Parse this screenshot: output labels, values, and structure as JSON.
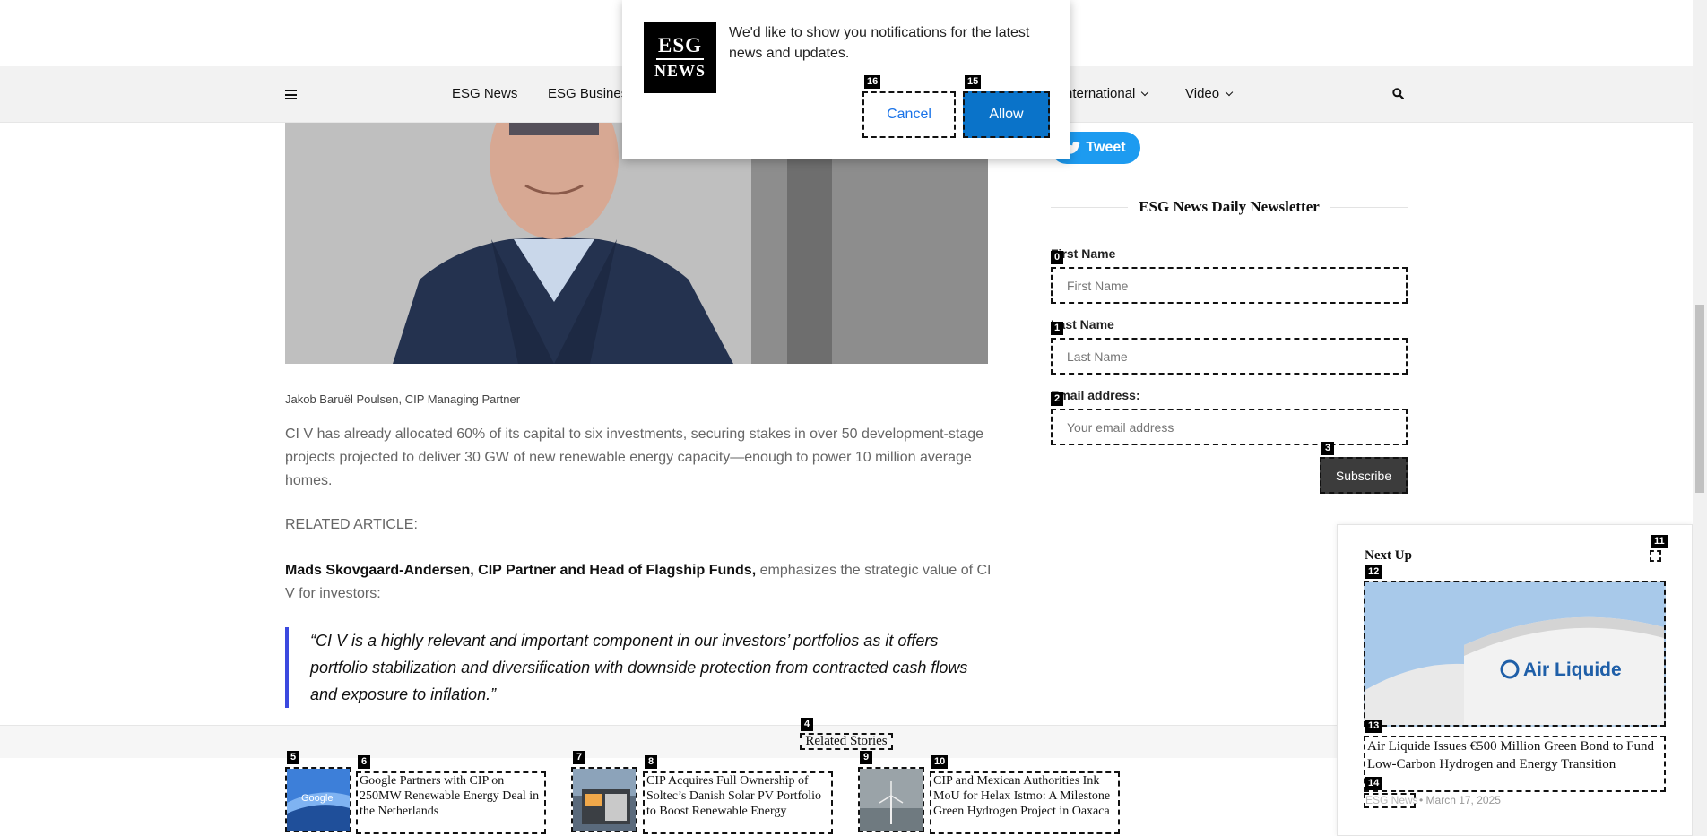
{
  "nav": {
    "links": [
      {
        "label": "ESG News",
        "has_caret": false
      },
      {
        "label": "ESG Business",
        "has_caret": false
      },
      {
        "label": "nternational",
        "has_caret": true
      },
      {
        "label": "Video",
        "has_caret": true
      }
    ],
    "menu_icon": "hamburger-icon",
    "search_icon": "search-icon"
  },
  "popup": {
    "logo_line1": "ESG",
    "logo_line2": "NEWS",
    "message": "We'd like to show you notifications for the latest news and updates.",
    "cancel_label": "Cancel",
    "allow_label": "Allow",
    "allow_color": "#0a73c9"
  },
  "article": {
    "image_caption": "Jakob Baruël Poulsen, CIP Managing Partner",
    "paragraph1": "CI V has already allocated 60% of its capital to six investments, securing stakes in over 50 development-stage projects projected to deliver 30 GW of new renewable energy capacity—enough to power 10 million average homes.",
    "related_label": "RELATED ARTICLE:",
    "paragraph2_bold": "Mads Skovgaard-Andersen, CIP Partner and Head of Flagship Funds,",
    "paragraph2_rest": " emphasizes the strategic value of CI V for investors:",
    "quote": "“CI V is a highly relevant and important component in our investors’ portfolios as it offers portfolio stabilization and diversification with downside protection from contracted cash flows and exposure to inflation.”",
    "quote_accent": "#3b49df"
  },
  "sidebar": {
    "tweet_label": "Tweet",
    "newsletter_title": "ESG News Daily Newsletter",
    "first_name_label": "First Name",
    "first_name_placeholder": "First Name",
    "last_name_label": "Last Name",
    "last_name_placeholder": "Last Name",
    "email_label": "Email address:",
    "email_placeholder": "Your email address",
    "subscribe_label": "Subscribe"
  },
  "next_up": {
    "title": "Next Up",
    "headline": "Air Liquide Issues €500 Million Green Bond to Fund Low-Carbon Hydrogen and Energy Transition",
    "category": "ESG News",
    "date": "• March 17, 2025",
    "image_brand": "Air Liquide"
  },
  "related": {
    "title": "Related Stories",
    "items": [
      {
        "headline": "Google Partners with CIP on 250MW Renewable Energy Deal in the Netherlands"
      },
      {
        "headline": "CIP Acquires Full Ownership of Soltec’s Danish Solar PV Portfolio to Boost Renewable Energy"
      },
      {
        "headline": "CIP and Mexican Authorities Ink MoU for Helax Istmo: A Milestone Green Hydrogen Project in Oaxaca"
      }
    ]
  },
  "markers": [
    "0",
    "1",
    "2",
    "3",
    "4",
    "5",
    "6",
    "7",
    "8",
    "9",
    "10",
    "11",
    "12",
    "13",
    "14",
    "15",
    "16"
  ]
}
